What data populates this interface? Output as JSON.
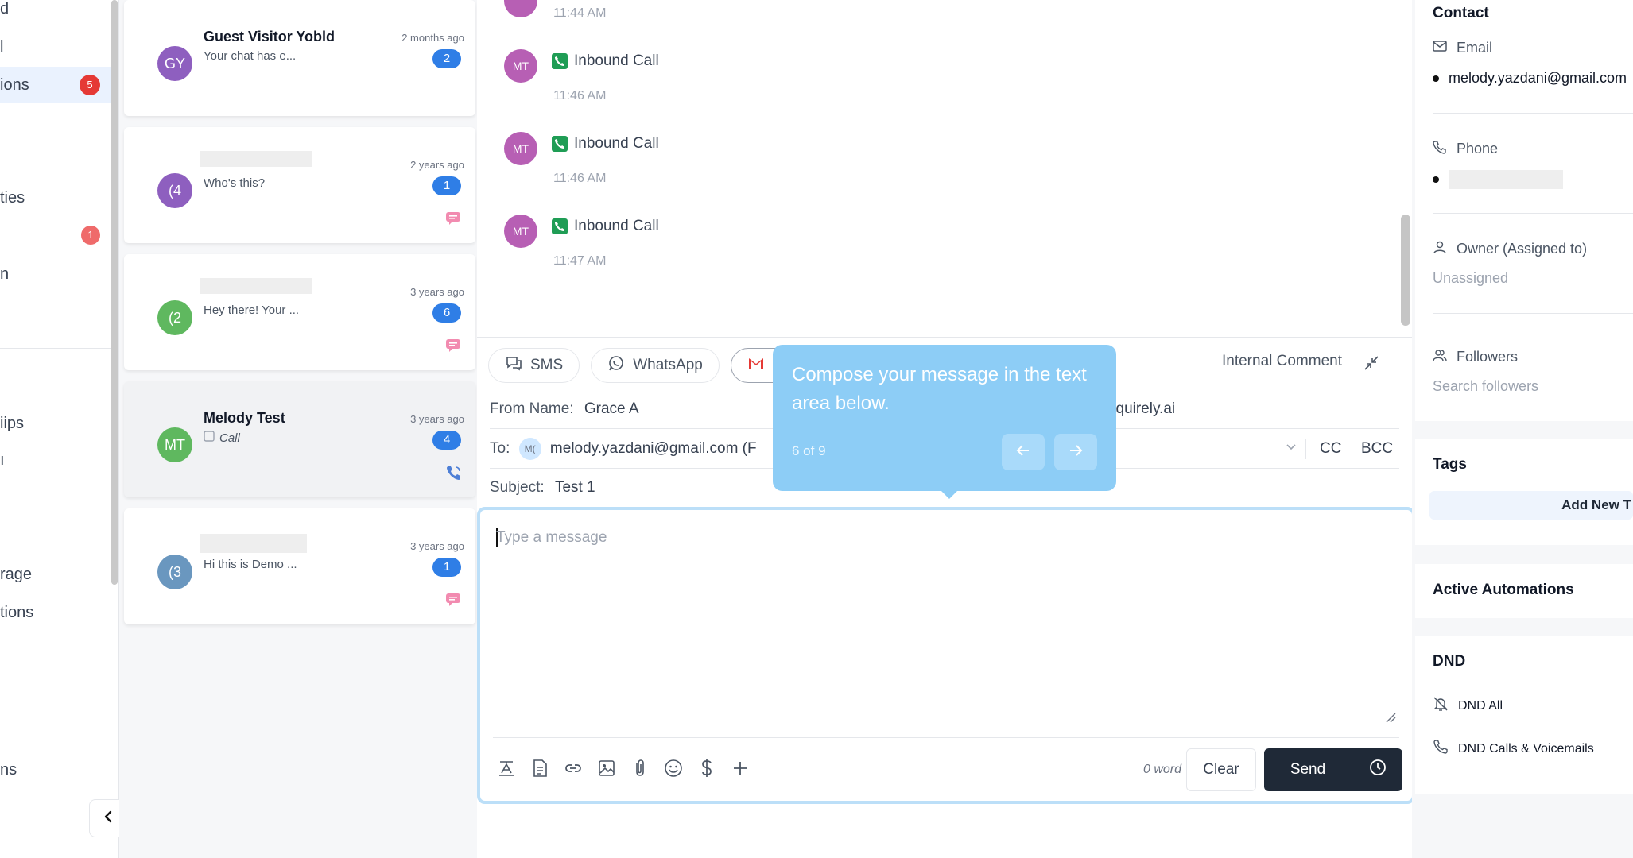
{
  "nav": {
    "items": [
      {
        "label": "d"
      },
      {
        "label": "l"
      },
      {
        "label": "ions"
      },
      {
        "label": "ties"
      },
      {
        "label": "n"
      },
      {
        "label": "iips"
      },
      {
        "label": "ı"
      },
      {
        "label": "rage"
      },
      {
        "label": "tions"
      },
      {
        "label": "ns"
      }
    ],
    "badges": [
      "5",
      "1"
    ],
    "colors": {
      "badge_primary": "#e53935",
      "badge_secondary": "#ef6b6b",
      "active_bg": "#eaf2fe"
    }
  },
  "conversations": [
    {
      "initials": "GY",
      "name": "Guest Visitor Yobld",
      "snippet": "Your chat has e...",
      "time": "2 months ago",
      "count": "2",
      "avatar_color": "#8e5fbf",
      "icon": ""
    },
    {
      "initials": "(4",
      "name": "",
      "snippet": "Who's this?",
      "time": "2 years ago",
      "count": "1",
      "avatar_color": "#8e5fbf",
      "icon": "message-icon"
    },
    {
      "initials": "(2",
      "name": "",
      "snippet": "Hey there! Your ...",
      "time": "3 years ago",
      "count": "6",
      "avatar_color": "#5fb85f",
      "icon": "message-icon"
    },
    {
      "initials": "MT",
      "name": "Melody Test",
      "snippet": "Call",
      "time": "3 years ago",
      "count": "4",
      "avatar_color": "#5fb85f",
      "icon": "phone-icon"
    },
    {
      "initials": "(3",
      "name": "",
      "snippet": "Hi this is Demo ...",
      "time": "3 years ago",
      "count": "1",
      "avatar_color": "#6a97bf",
      "icon": "message-icon"
    }
  ],
  "chat": {
    "top_time": "11:44 AM",
    "calls": [
      {
        "initials": "MT",
        "label": "Inbound Call",
        "time": "11:46 AM"
      },
      {
        "initials": "MT",
        "label": "Inbound Call",
        "time": "11:46 AM"
      },
      {
        "initials": "MT",
        "label": "Inbound Call",
        "time": "11:47 AM"
      }
    ]
  },
  "composer": {
    "tabs": {
      "sms": "SMS",
      "whatsapp": "WhatsApp",
      "email": "M"
    },
    "internal_comment": "Internal Comment",
    "from_label": "From Name:",
    "from_value": "Grace A",
    "from_domain_tail": "cquirely.ai",
    "to_label": "To:",
    "to_avatar": "M(",
    "to_value": "melody.yazdani@gmail.com (F",
    "cc": "CC",
    "bcc": "BCC",
    "subject_label": "Subject:",
    "subject_value": "Test 1",
    "placeholder": "Type a message",
    "word_count": "0 word",
    "clear": "Clear",
    "send": "Send"
  },
  "tooltip": {
    "text": "Compose your message in the text area below.",
    "step": "6 of 9"
  },
  "right_panel": {
    "contact_title": "Contact",
    "email_label": "Email",
    "email_value": "melody.yazdani@gmail.com",
    "phone_label": "Phone",
    "owner_label": "Owner (Assigned to)",
    "owner_value": "Unassigned",
    "followers_label": "Followers",
    "followers_placeholder": "Search followers",
    "tags_title": "Tags",
    "add_new": "Add New T",
    "automations_title": "Active Automations",
    "dnd_title": "DND",
    "dnd_all": "DND All",
    "dnd_calls": "DND Calls & Voicemails"
  }
}
